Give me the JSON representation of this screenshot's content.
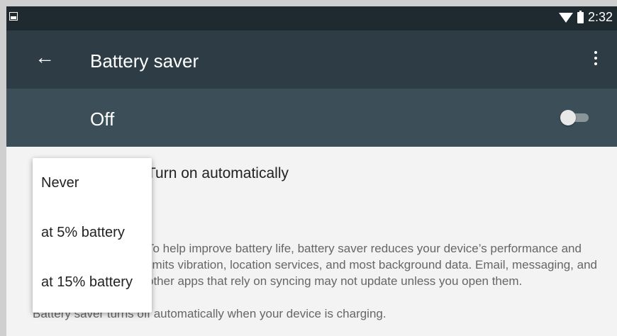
{
  "status_bar": {
    "time": "2:32",
    "icons": [
      "image-icon",
      "wifi-icon",
      "battery-icon"
    ]
  },
  "app_bar": {
    "title": "Battery saver",
    "back_icon": "arrow-back-icon",
    "menu_icon": "more-vert-icon"
  },
  "master_switch": {
    "label": "Off",
    "state": "off"
  },
  "settings": {
    "auto_title": "Turn on automatically",
    "description": "To help improve battery life, battery saver reduces your device’s performance and limits vibration, location services, and most background data. Email, messaging, and other apps that rely on syncing may not update unless you open them.",
    "charging_note": "Battery saver turns off automatically when your device is charging."
  },
  "dropdown": {
    "options": [
      "Never",
      "at 5% battery",
      "at 15% battery"
    ]
  },
  "colors": {
    "status_bar": "#1f2a30",
    "app_bar": "#2e3d45",
    "master_bar": "#3c4e57",
    "background": "#f3f3f3"
  }
}
